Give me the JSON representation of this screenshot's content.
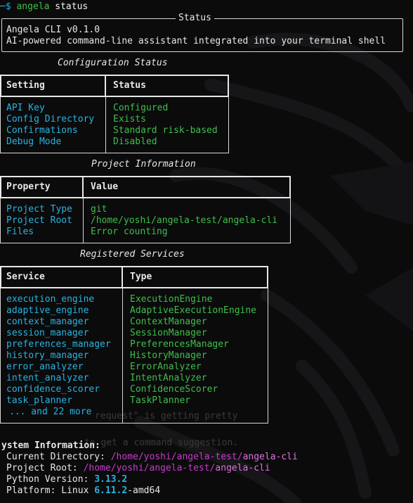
{
  "prompt": {
    "prefix": "─$",
    "command": "angela",
    "argument": "status"
  },
  "status_panel": {
    "title": "Status",
    "line1": "Angela CLI v0.1.0",
    "line2": "AI-powered command-line assistant integrated into your terminal shell"
  },
  "config_table": {
    "title": "Configuration Status",
    "headers": [
      "Setting",
      "Status"
    ],
    "rows": [
      [
        "API Key",
        "Configured"
      ],
      [
        "Config Directory",
        "Exists"
      ],
      [
        "Confirmations",
        "Standard risk-based"
      ],
      [
        "Debug Mode",
        "Disabled"
      ]
    ]
  },
  "project_table": {
    "title": "Project Information",
    "headers": [
      "Property",
      "Value"
    ],
    "rows": [
      [
        "Project Type",
        "git"
      ],
      [
        "Project Root",
        "/home/yoshi/angela-test/angela-cli"
      ],
      [
        "Files",
        "Error counting"
      ]
    ]
  },
  "services_table": {
    "title": "Registered Services",
    "headers": [
      "Service",
      "Type"
    ],
    "rows": [
      [
        "execution_engine",
        "ExecutionEngine"
      ],
      [
        "adaptive_engine",
        "AdaptiveExecutionEngine"
      ],
      [
        "context_manager",
        "ContextManager"
      ],
      [
        "session_manager",
        "SessionManager"
      ],
      [
        "preferences_manager",
        "PreferencesManager"
      ],
      [
        "history_manager",
        "HistoryManager"
      ],
      [
        "error_analyzer",
        "ErrorAnalyzer"
      ],
      [
        "intent_analyzer",
        "IntentAnalyzer"
      ],
      [
        "confidence_scorer",
        "ConfidenceScorer"
      ],
      [
        "task_planner",
        "TaskPlanner"
      ]
    ],
    "more": "... and 22 more"
  },
  "system_info": {
    "title": "ystem Information:",
    "current_dir_label": "Current Directory:",
    "current_dir_path": "/home/yoshi/angela-test/",
    "current_dir_leaf": "angela-cli",
    "project_root_label": "Project Root:",
    "project_root_path": "/home/yoshi/angela-test/",
    "project_root_leaf": "angela-cli",
    "python_label": "Python Version:",
    "python_value": "3.13.2",
    "platform_label": "Platform: Linux",
    "platform_version": "6.11.2",
    "platform_arch": "-amd64"
  },
  "ghost_text": {
    "line1": "request\" is getting pretty",
    "line2": "to get a command suggestion."
  },
  "colors": {
    "background": "#0b0b0c",
    "green": "#3fbf4a",
    "blue": "#29b3e0",
    "magenta": "#c83cc8"
  }
}
